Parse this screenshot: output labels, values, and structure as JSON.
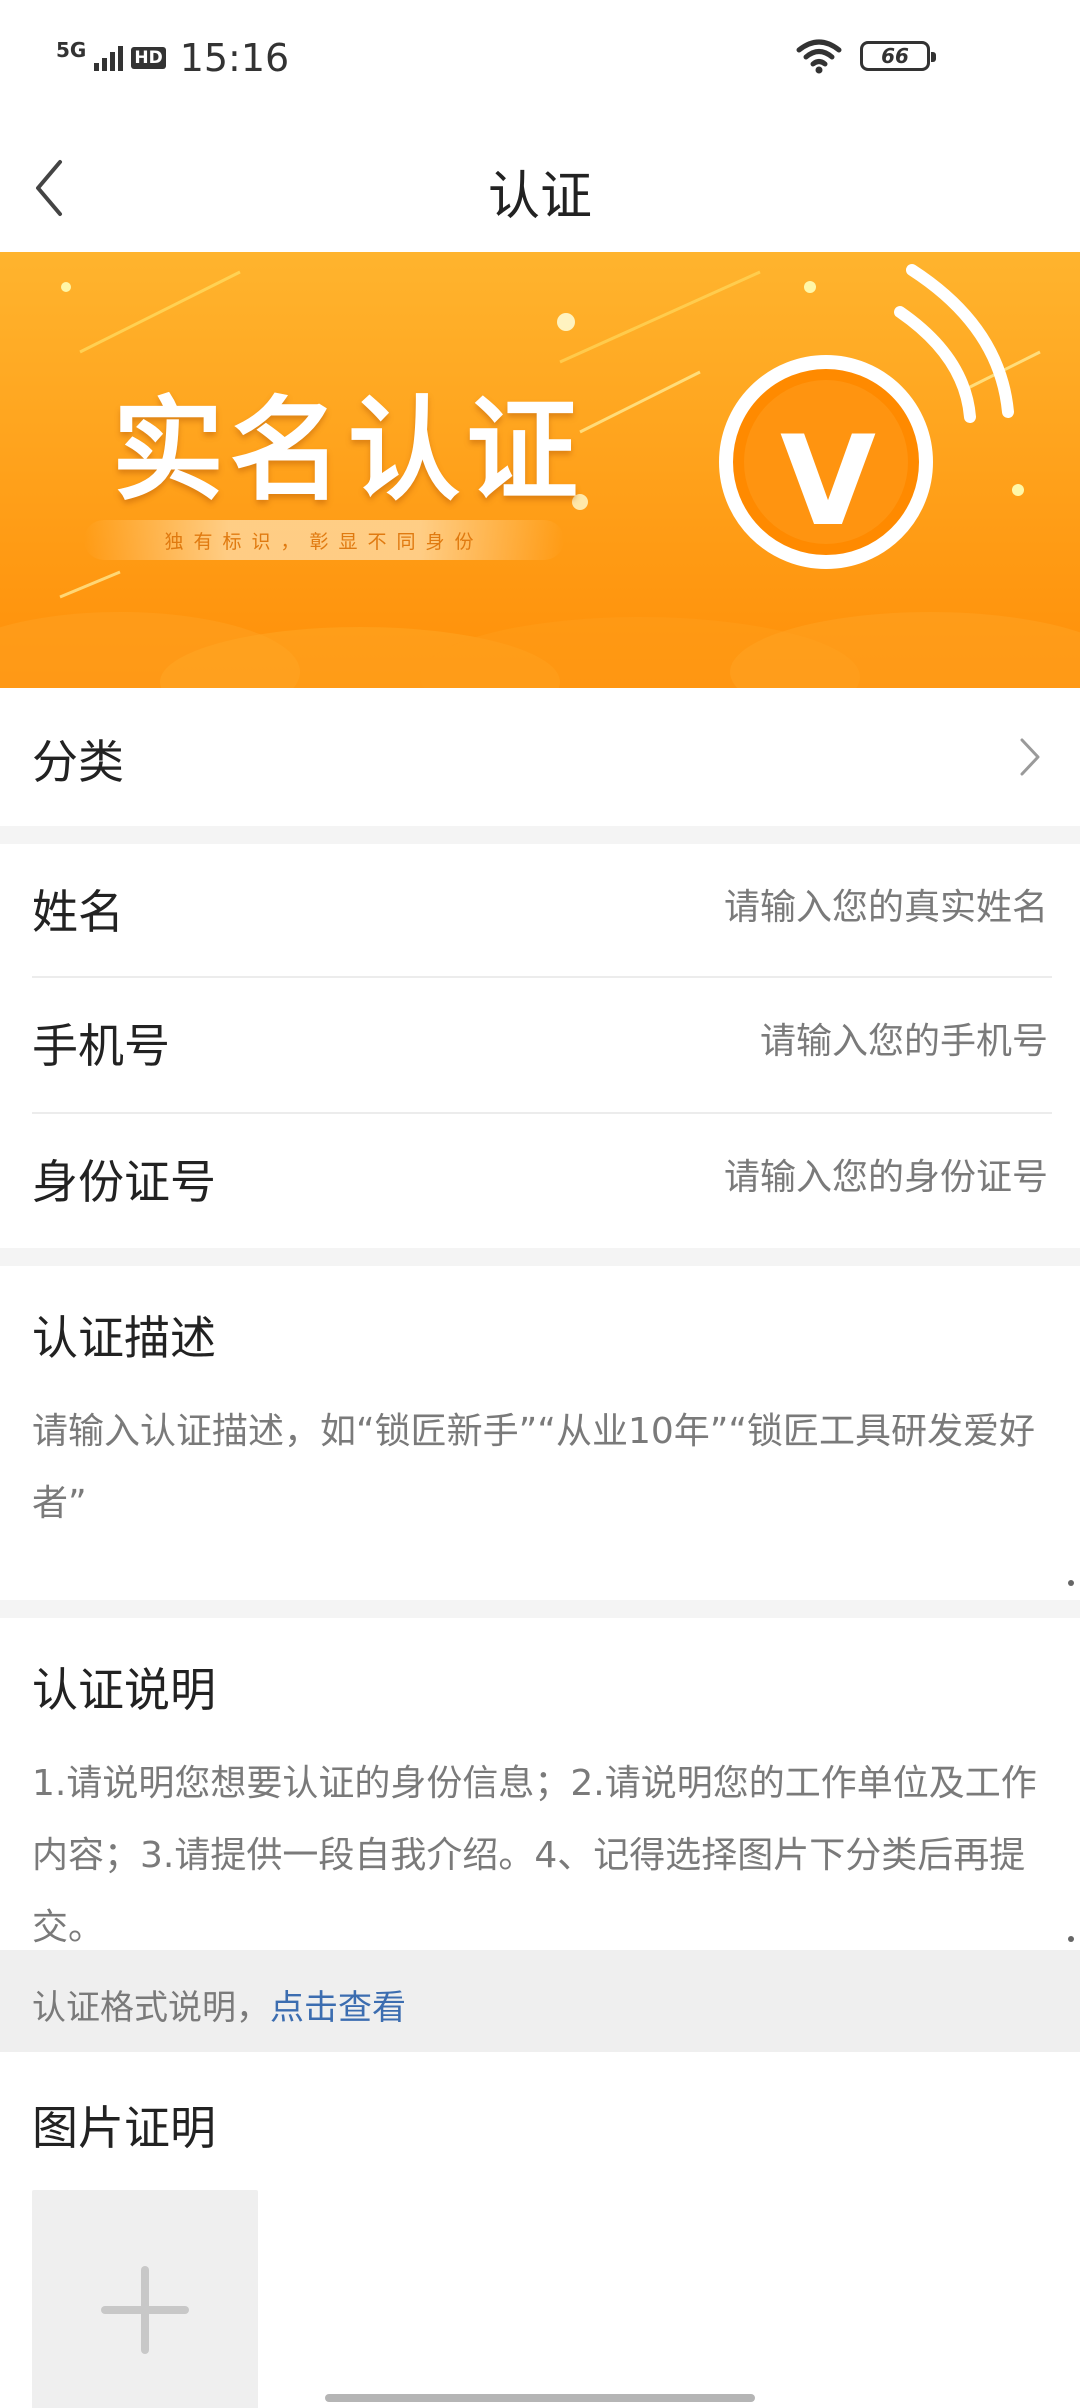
{
  "status_bar": {
    "network": "5G",
    "hd": "HD",
    "time": "15:16",
    "battery": "66"
  },
  "nav": {
    "title": "认证",
    "back_icon": "chevron-left-icon"
  },
  "banner": {
    "title": "实名认证",
    "subtitle": "独有标识，彰显不同身份",
    "badge_letter": "V",
    "colors": {
      "from": "#ffb42e",
      "to": "#ff8f08"
    }
  },
  "category": {
    "label": "分类",
    "icon": "chevron-right-icon"
  },
  "form": {
    "name": {
      "label": "姓名",
      "placeholder": "请输入您的真实姓名"
    },
    "phone": {
      "label": "手机号",
      "placeholder": "请输入您的手机号"
    },
    "id_number": {
      "label": "身份证号",
      "placeholder": "请输入您的身份证号"
    }
  },
  "description": {
    "title": "认证描述",
    "placeholder": "请输入认证描述，如“锁匠新手”“从业10年”“锁匠工具研发爱好者”"
  },
  "explanation": {
    "title": "认证说明",
    "text": "1.请说明您想要认证的身份信息；2.请说明您的工作单位及工作内容；3.请提供一段自我介绍。4、记得选择图片下分类后再提交。"
  },
  "format": {
    "prefix": "认证格式说明，",
    "link": "点击查看",
    "link_color": "#3c6db0"
  },
  "photo": {
    "title": "图片证明",
    "add_icon": "plus-icon"
  }
}
